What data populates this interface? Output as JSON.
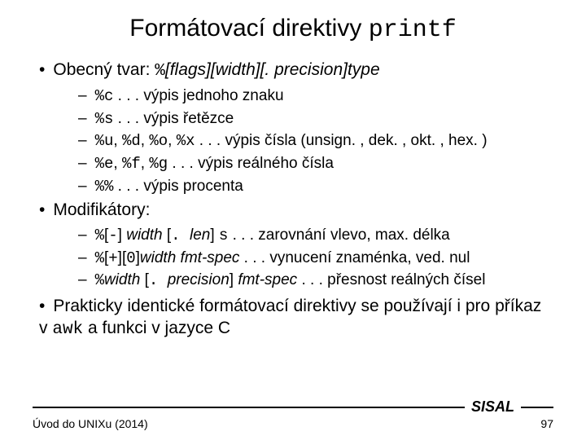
{
  "title_a": "Formátovací direktivy ",
  "title_b": "printf",
  "b1_pre": "Obecný tvar: ",
  "b1_pct": "%",
  "b1_syntax": "[flags][width][. precision]type",
  "s1_c": "%c",
  "s1_t": " . . . výpis jednoho znaku",
  "s2_c": "%s",
  "s2_t": " . . . výpis řetězce",
  "s3_c1": "%u",
  "s3_c2": "%d",
  "s3_c3": "%o",
  "s3_c4": "%x",
  "s3_t": " . . . výpis čísla (unsign. , dek. , okt. , hex. )",
  "s4_c1": "%e",
  "s4_c2": "%f",
  "s4_c3": "%g",
  "s4_t": " . . . výpis reálného čísla",
  "s5_c": "%%",
  "s5_t": " . . . výpis procenta",
  "b2": "Modifikátory:",
  "m1_a": "%",
  "m1_b": "[",
  "m1_c": "-",
  "m1_d": "]",
  "m1_w": " width ",
  "m1_e": "[",
  "m1_f": ". ",
  "m1_g": "len",
  "m1_h": "] ",
  "m1_i": "s",
  "m1_t": "  . . . zarovnání vlevo, max. délka",
  "m2_a": "%",
  "m2_b": "[",
  "m2_c": "+",
  "m2_d": "][",
  "m2_e": "0",
  "m2_f": "]",
  "m2_g": "width fmt-spec",
  "m2_t": " . . . vynucení znaménka, ved. nul",
  "m3_a": "%",
  "m3_b": "width ",
  "m3_c": "[",
  "m3_d": ". ",
  "m3_e": "precision",
  "m3_f": "] ",
  "m3_g": "fmt-spec",
  "m3_t": " . . . přesnost reálných čísel",
  "b3_a": "Prakticky identické formátovací direktivy se používají i pro příkaz v ",
  "b3_b": "awk",
  "b3_c": " a funkci v jazyce C",
  "footer_left": "Úvod do UNIXu (2014)",
  "footer_brand": "SISAL",
  "footer_page": "97",
  "sep": ", "
}
